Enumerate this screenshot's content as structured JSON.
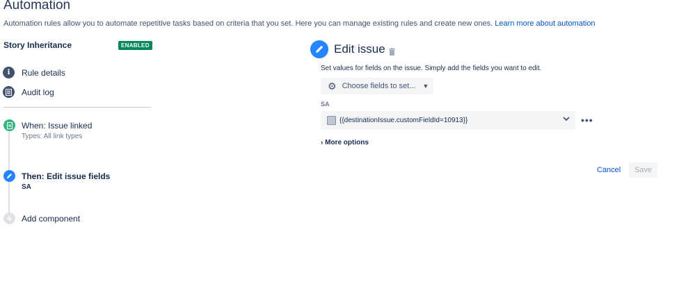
{
  "page": {
    "title": "Automation",
    "intro": "Automation rules allow you to automate repetitive tasks based on criteria that you set. Here you can manage existing rules and create new ones. ",
    "learn_more": "Learn more about automation"
  },
  "rule": {
    "name": "Story Inheritance",
    "status": "ENABLED",
    "status_color": "#00875a"
  },
  "nav": {
    "rule_details": "Rule details",
    "audit_log": "Audit log"
  },
  "steps": {
    "trigger_title": "When: Issue linked",
    "trigger_sub": "Types: All link types",
    "action_title": "Then: Edit issue fields",
    "action_sub": "SA",
    "add": "Add component"
  },
  "editor": {
    "title": "Edit issue",
    "description": "Set values for fields on the issue. Simply add the fields you want to edit.",
    "choose_fields": "Choose fields to set...",
    "field_label": "SA",
    "field_value": "{{destinationIssue.customFieldId=10913}}",
    "more_options": "More options",
    "cancel": "Cancel",
    "save": "Save"
  }
}
